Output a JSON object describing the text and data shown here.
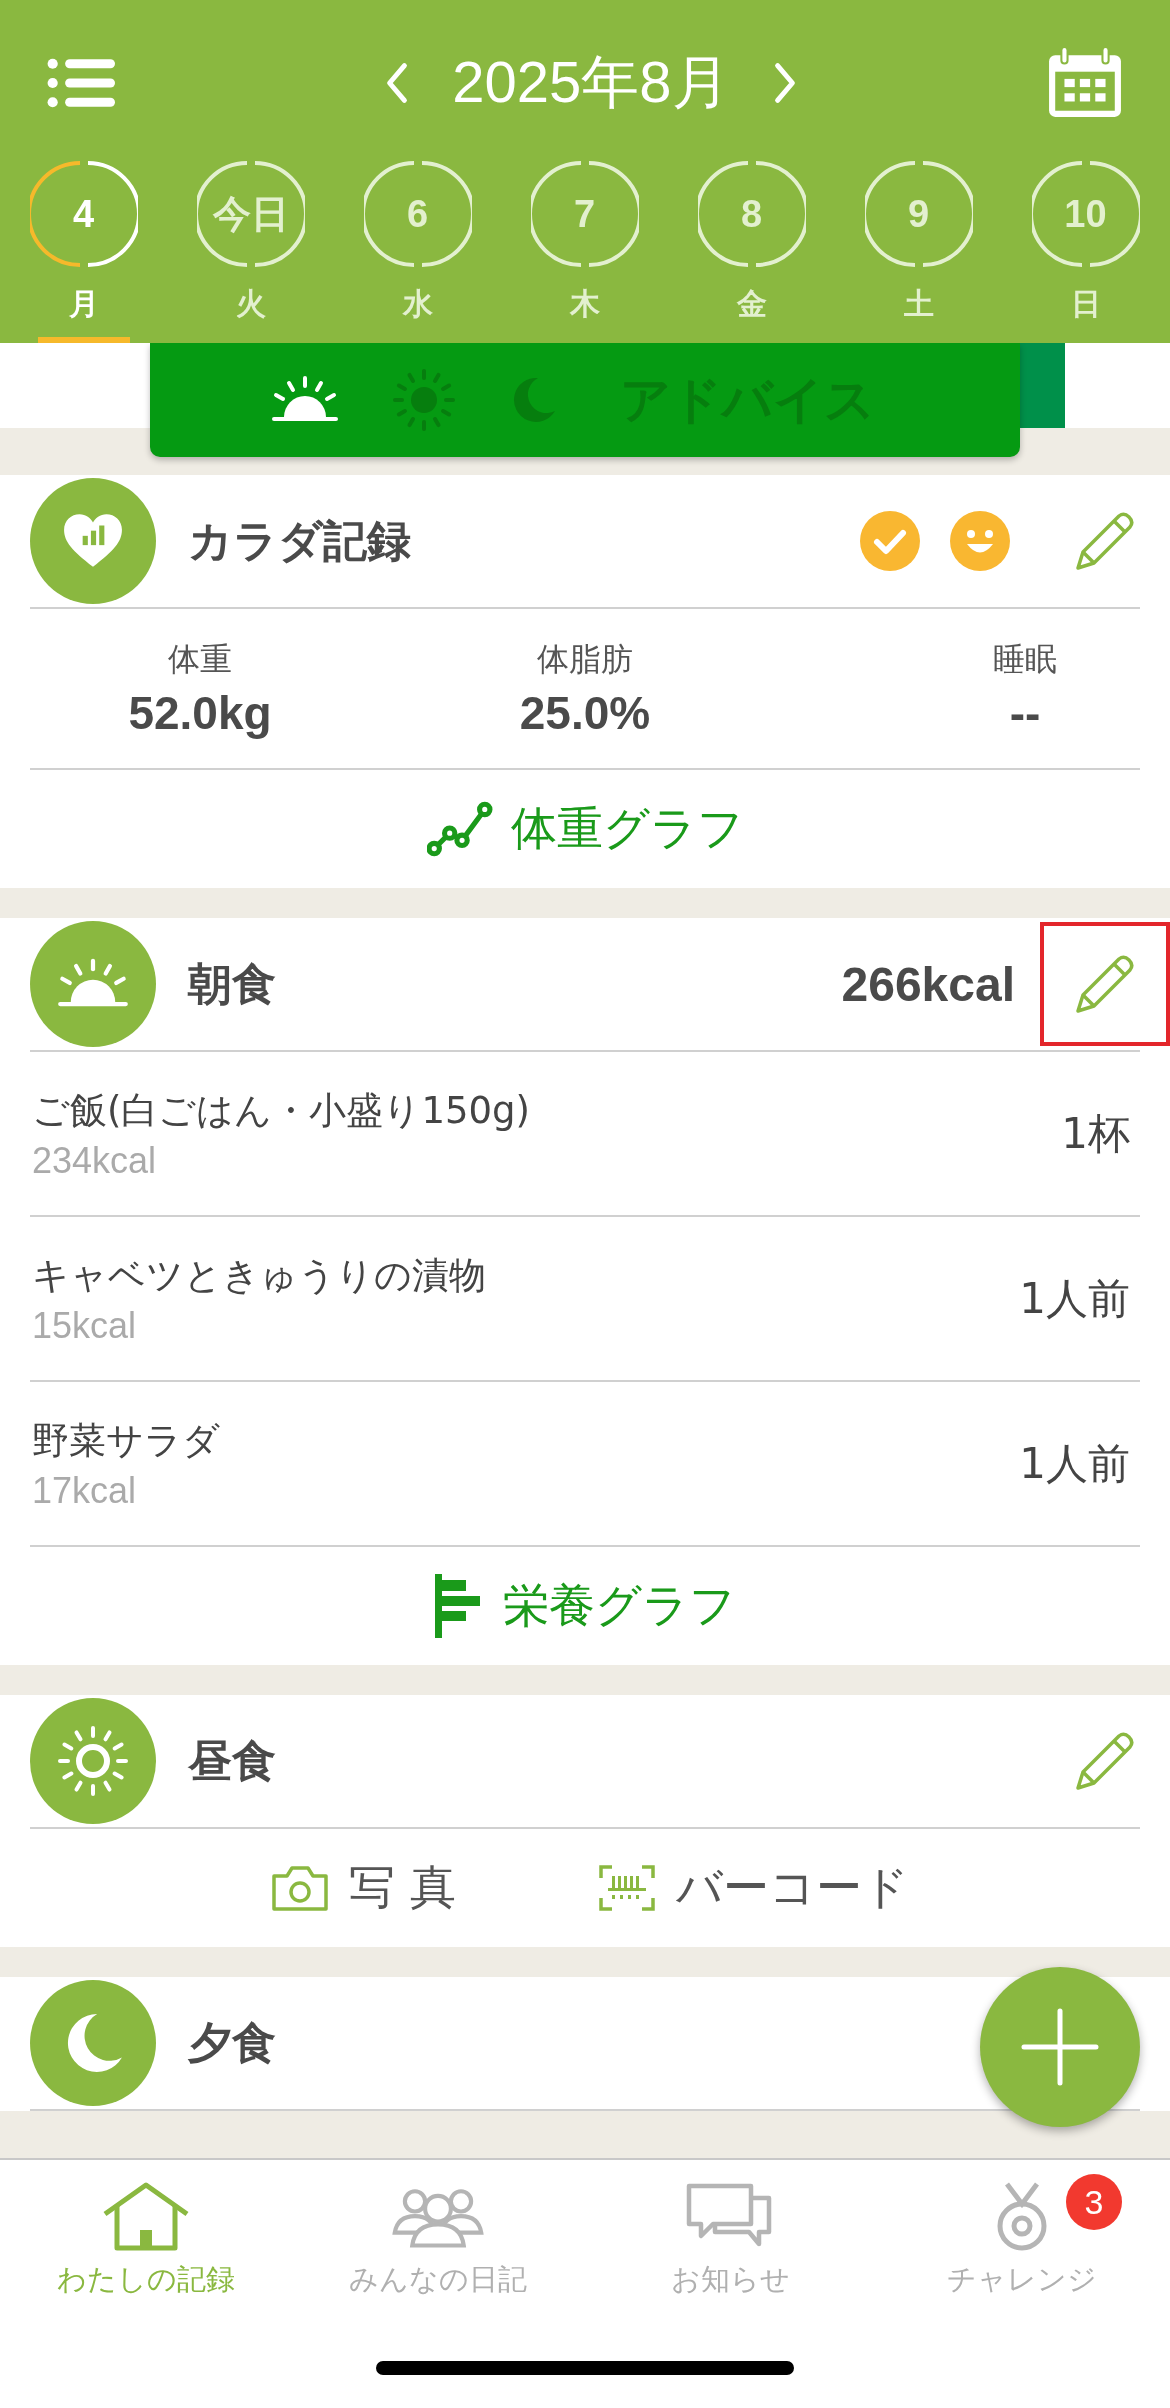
{
  "header": {
    "title": "2025年8月"
  },
  "days": [
    {
      "number": "4",
      "weekday": "月",
      "selected": true
    },
    {
      "number": "今日",
      "weekday": "火",
      "selected": false
    },
    {
      "number": "6",
      "weekday": "水",
      "selected": false
    },
    {
      "number": "7",
      "weekday": "木",
      "selected": false
    },
    {
      "number": "8",
      "weekday": "金",
      "selected": false
    },
    {
      "number": "9",
      "weekday": "土",
      "selected": false
    },
    {
      "number": "10",
      "weekday": "日",
      "selected": false
    }
  ],
  "advice_tabs": [
    {
      "kind": "morning",
      "selected": true
    },
    {
      "kind": "noon",
      "selected": false
    },
    {
      "kind": "night",
      "selected": false
    },
    {
      "kind": "advice",
      "label": "アドバイス",
      "selected": false
    }
  ],
  "body_record": {
    "title": "カラダ記録",
    "stats": [
      {
        "label": "体重",
        "value": "52.0kg"
      },
      {
        "label": "体脂肪",
        "value": "25.0%"
      },
      {
        "label": "睡眠",
        "value": "--"
      }
    ],
    "graph_link": "体重グラフ"
  },
  "meals": [
    {
      "kind": "breakfast",
      "title": "朝食",
      "total": "266kcal",
      "editable": true,
      "highlighted": true,
      "items": [
        {
          "name": "ご飯(白ごはん・小盛り150g)",
          "kcal": "234kcal",
          "amount": "1杯"
        },
        {
          "name": "キャベツときゅうりの漬物",
          "kcal": "15kcal",
          "amount": "1人前"
        },
        {
          "name": "野菜サラダ",
          "kcal": "17kcal",
          "amount": "1人前"
        }
      ],
      "graph_link": "栄養グラフ"
    },
    {
      "kind": "lunch",
      "title": "昼食",
      "editable": true,
      "highlighted": false,
      "actions": [
        {
          "kind": "photo",
          "label": "写 真"
        },
        {
          "kind": "barcode",
          "label": "バーコード"
        }
      ]
    },
    {
      "kind": "dinner",
      "title": "夕食",
      "editable": false
    }
  ],
  "nav": [
    {
      "kind": "home",
      "label": "わたしの記録",
      "selected": true
    },
    {
      "kind": "people",
      "label": "みんなの日記",
      "selected": false
    },
    {
      "kind": "chat",
      "label": "お知らせ",
      "selected": false
    },
    {
      "kind": "medal",
      "label": "チャレンジ",
      "selected": false,
      "badge": "3"
    }
  ]
}
